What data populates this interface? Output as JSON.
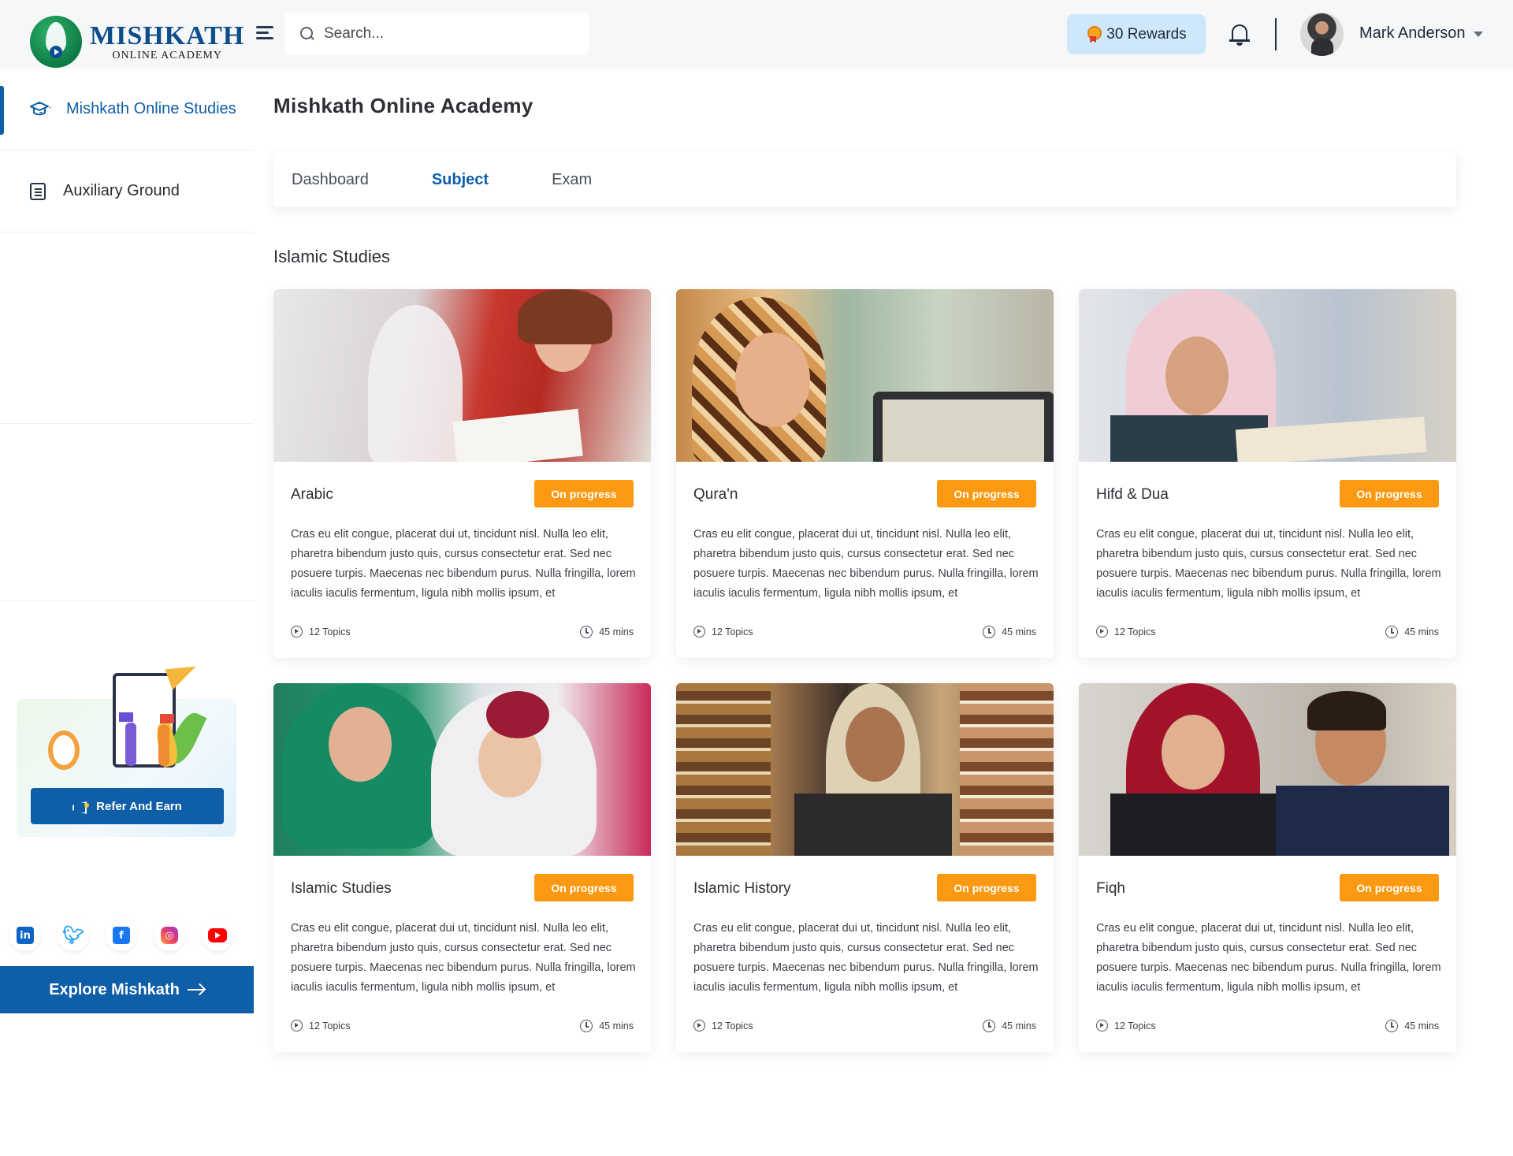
{
  "brand": {
    "title": "MISHKATH",
    "subtitle": "ONLINE ACADEMY"
  },
  "search": {
    "placeholder": "Search..."
  },
  "rewards": {
    "label": "30 Rewards"
  },
  "user": {
    "name": "Mark Anderson"
  },
  "sidebar": {
    "items": [
      {
        "label": "Mishkath Online Studies",
        "icon": "graduation-cap-icon",
        "active": true
      },
      {
        "label": "Auxiliary Ground",
        "icon": "document-icon",
        "active": false
      }
    ],
    "refer_label": "Refer And Earn",
    "social": [
      "linkedin-icon",
      "twitter-icon",
      "facebook-icon",
      "instagram-icon",
      "youtube-icon"
    ],
    "explore_label": "Explore Mishkath"
  },
  "main": {
    "title": "Mishkath Online Academy",
    "tabs": [
      {
        "label": "Dashboard",
        "active": false
      },
      {
        "label": "Subject",
        "active": true
      },
      {
        "label": "Exam",
        "active": false
      }
    ],
    "section_title": "Islamic Studies",
    "cards": [
      {
        "title": "Arabic",
        "status": "On progress",
        "description": "Cras eu elit congue, placerat dui ut, tincidunt nisl. Nulla leo elit, pharetra bibendum justo quis, cursus consectetur erat. Sed nec posuere turpis. Maecenas nec bibendum purus. Nulla fringilla, lorem iaculis iaculis fermentum, ligula nibh mollis ipsum, et",
        "topics": "12 Topics",
        "duration": "45 mins"
      },
      {
        "title": "Qura'n",
        "status": "On progress",
        "description": "Cras eu elit congue, placerat dui ut, tincidunt nisl. Nulla leo elit, pharetra bibendum justo quis, cursus consectetur erat. Sed nec posuere turpis. Maecenas nec bibendum purus. Nulla fringilla, lorem iaculis iaculis fermentum, ligula nibh mollis ipsum, et",
        "topics": "12 Topics",
        "duration": "45 mins"
      },
      {
        "title": "Hifd & Dua",
        "status": "On progress",
        "description": "Cras eu elit congue, placerat dui ut, tincidunt nisl. Nulla leo elit, pharetra bibendum justo quis, cursus consectetur erat. Sed nec posuere turpis. Maecenas nec bibendum purus. Nulla fringilla, lorem iaculis iaculis fermentum, ligula nibh mollis ipsum, et",
        "topics": "12 Topics",
        "duration": "45 mins"
      },
      {
        "title": "Islamic Studies",
        "status": "On progress",
        "description": "Cras eu elit congue, placerat dui ut, tincidunt nisl. Nulla leo elit, pharetra bibendum justo quis, cursus consectetur erat. Sed nec posuere turpis. Maecenas nec bibendum purus. Nulla fringilla, lorem iaculis iaculis fermentum, ligula nibh mollis ipsum, et",
        "topics": "12 Topics",
        "duration": "45 mins"
      },
      {
        "title": "Islamic History",
        "status": "On progress",
        "description": "Cras eu elit congue, placerat dui ut, tincidunt nisl. Nulla leo elit, pharetra bibendum justo quis, cursus consectetur erat. Sed nec posuere turpis. Maecenas nec bibendum purus. Nulla fringilla, lorem iaculis iaculis fermentum, ligula nibh mollis ipsum, et",
        "topics": "12 Topics",
        "duration": "45 mins"
      },
      {
        "title": "Fiqh",
        "status": "On progress",
        "description": "Cras eu elit congue, placerat dui ut, tincidunt nisl. Nulla leo elit, pharetra bibendum justo quis, cursus consectetur erat. Sed nec posuere turpis. Maecenas nec bibendum purus. Nulla fringilla, lorem iaculis iaculis fermentum, ligula nibh mollis ipsum, et",
        "topics": "12 Topics",
        "duration": "45 mins"
      }
    ]
  },
  "colors": {
    "primary": "#0f5ea8",
    "badge": "#fb9a12",
    "rewards_bg": "#cfe7fb"
  }
}
